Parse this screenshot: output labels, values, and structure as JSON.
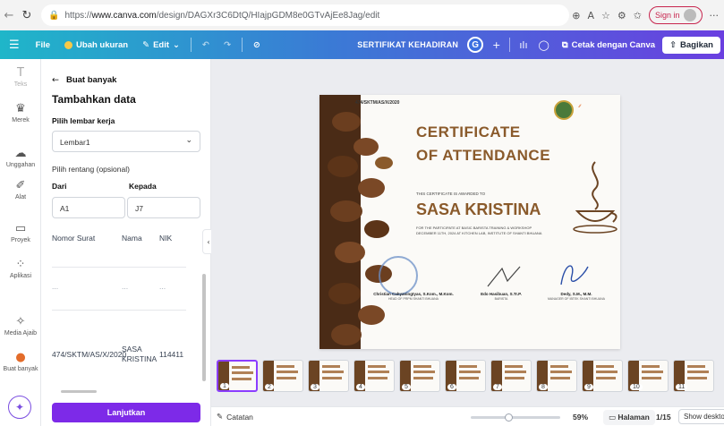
{
  "browser": {
    "url_prefix": "https://",
    "url_host": "www.canva.com",
    "url_path": "/design/DAGXr3C6DtQ/HIajpGDM8e0GTvAjEe8Jag/edit",
    "sign_in": "Sign in"
  },
  "toolbar": {
    "file": "File",
    "resize": "Ubah ukuran",
    "edit": "Edit",
    "doc_title": "SERTIFIKAT KEHADIRAN",
    "avatar_letter": "G",
    "print": "Cetak dengan Canva",
    "share": "Bagikan"
  },
  "rail": [
    {
      "label": "Teks"
    },
    {
      "label": "Merek"
    },
    {
      "label": "Unggahan"
    },
    {
      "label": "Alat"
    },
    {
      "label": "Proyek"
    },
    {
      "label": "Aplikasi"
    },
    {
      "label": "Media Ajaib"
    },
    {
      "label": "Buat banyak"
    }
  ],
  "panel": {
    "back_label": "Buat banyak",
    "heading": "Tambahkan data",
    "sheet_label": "Pilih lembar kerja",
    "sheet_value": "Lembar1",
    "range_label": "Pilih rentang (opsional)",
    "from_label": "Dari",
    "to_label": "Kepada",
    "from_value": "A1",
    "to_value": "J7",
    "columns": [
      "Nomor Surat",
      "Nama",
      "NIK"
    ],
    "dash_row": [
      "...",
      "...",
      "..."
    ],
    "data_row": [
      "474/SKTM/AS/X/2020",
      "SASA KRISTINA",
      "114411"
    ],
    "continue": "Lanjutkan"
  },
  "certificate": {
    "serial": "474/SKTM/AS/X/2020",
    "title_line1": "CERTIFICATE",
    "title_line2": "OF ATTENDANCE",
    "awarded": "THIS CERTIFICATE IS AWARDED TO",
    "recipient": "SASA KRISTINA",
    "description": "FOR THE PARTICIPATE AT BASIC BARISTA TRAINING & WORKSHOP DECEMBER 11TH, 2024 AT KITCHEN LAB, INSTITUTE OF SHANTI BHUANA",
    "signers": [
      {
        "name": "Christian Cahyaningtyas, S.Kom., M.Kom.",
        "role": "HEAD OF PRPM SHANTI BHUANA"
      },
      {
        "name": "Edo Hasibuan, S.Tr.P.",
        "role": "BARISTA"
      },
      {
        "name": "Dedy, S.M., M.M.",
        "role": "MANAGER OF IBTEK SHANTI BHUANA"
      }
    ]
  },
  "thumbnails": [
    "1",
    "2",
    "3",
    "4",
    "5",
    "6",
    "7",
    "8",
    "9",
    "10",
    "11"
  ],
  "bottom": {
    "notes": "Catatan",
    "zoom": "59%",
    "zoom_fraction": 0.42,
    "pages": "Halaman",
    "page_count": "1/15",
    "desktop_tip": "Show deskto"
  },
  "colors": {
    "accent_purple": "#7d2ae8",
    "cert_brown": "#8a5a2b",
    "toolbar_start": "#1fb6c9",
    "toolbar_end": "#6a3fe0"
  }
}
